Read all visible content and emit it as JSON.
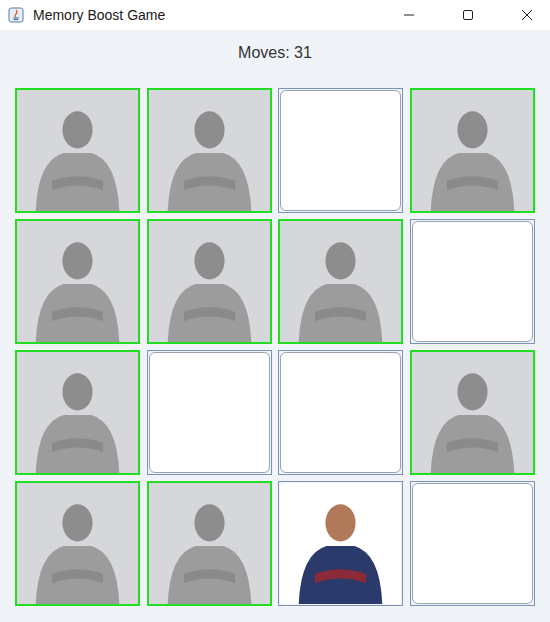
{
  "window": {
    "title": "Memory Boost Game"
  },
  "status": {
    "moves": "Moves: 31"
  },
  "cards": [
    {
      "face_up": true,
      "matched": true
    },
    {
      "face_up": true,
      "matched": true
    },
    {
      "face_up": false,
      "matched": false
    },
    {
      "face_up": true,
      "matched": true
    },
    {
      "face_up": true,
      "matched": true
    },
    {
      "face_up": true,
      "matched": true
    },
    {
      "face_up": true,
      "matched": true
    },
    {
      "face_up": false,
      "matched": false
    },
    {
      "face_up": true,
      "matched": true
    },
    {
      "face_up": false,
      "matched": false
    },
    {
      "face_up": false,
      "matched": false
    },
    {
      "face_up": true,
      "matched": true
    },
    {
      "face_up": true,
      "matched": true
    },
    {
      "face_up": true,
      "matched": true
    },
    {
      "face_up": true,
      "matched": false
    },
    {
      "face_up": false,
      "matched": false
    }
  ]
}
